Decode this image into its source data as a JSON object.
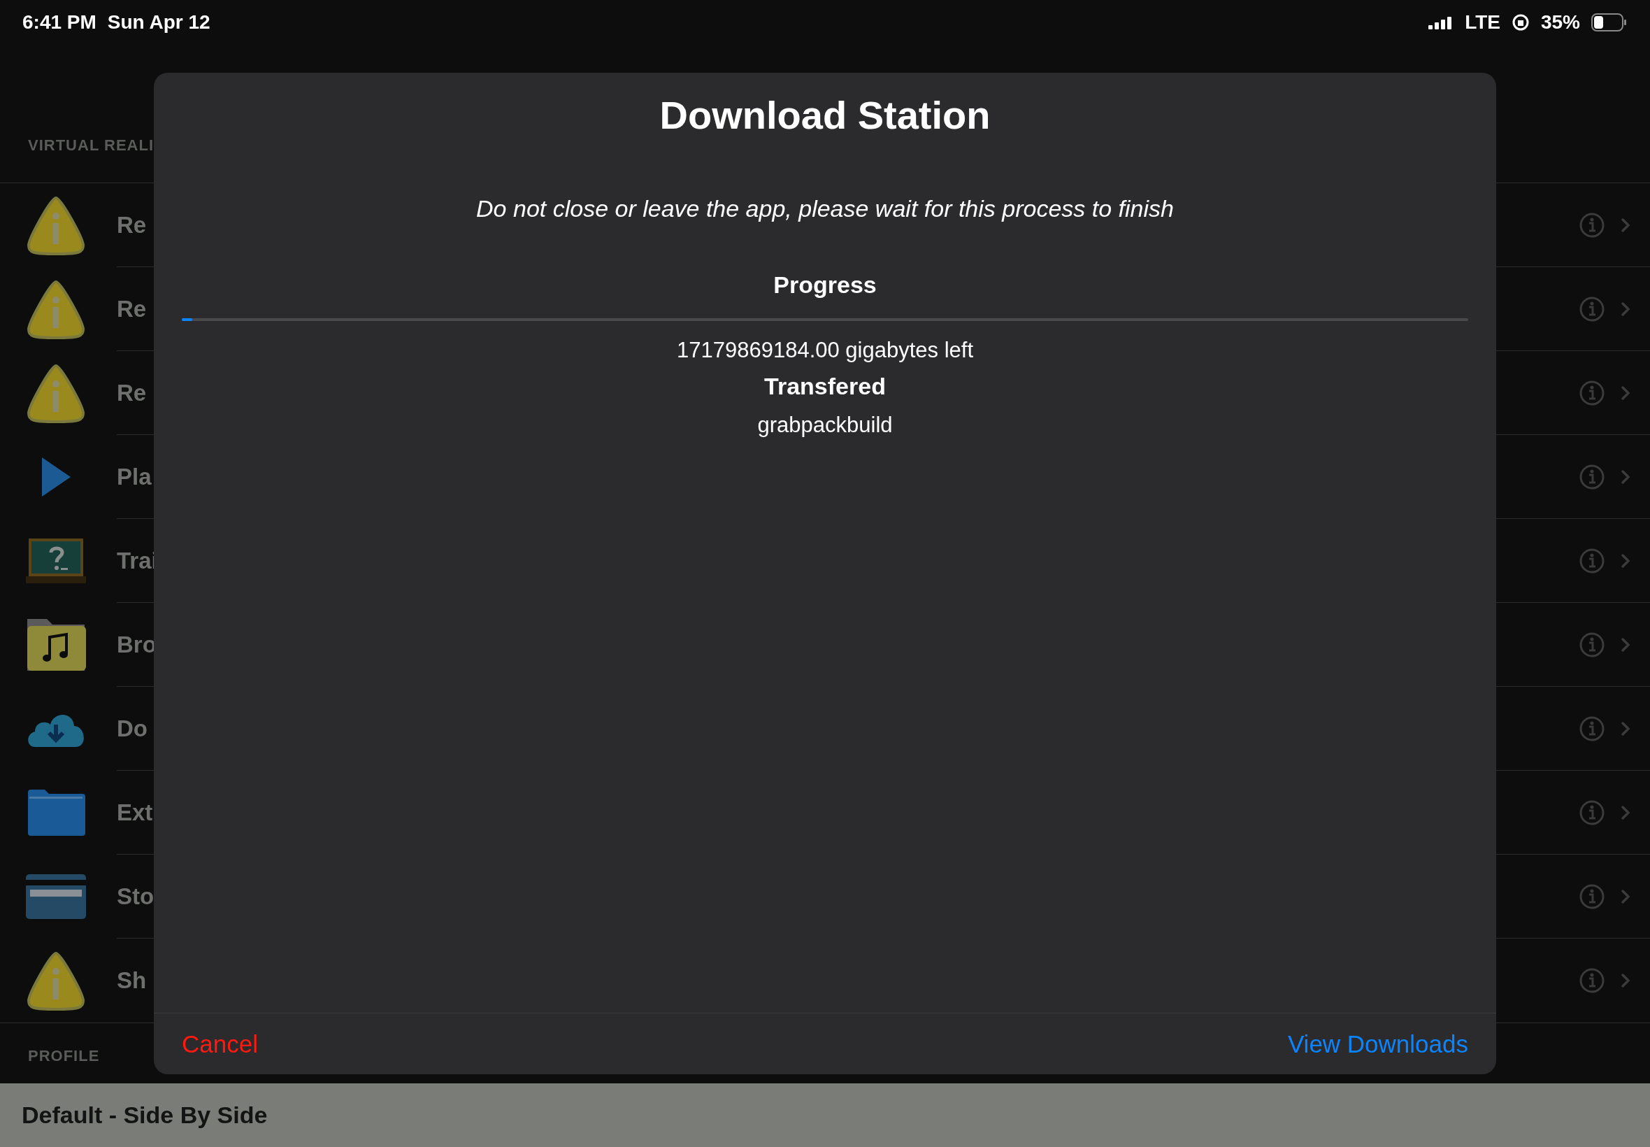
{
  "status_bar": {
    "time": "6:41 PM",
    "date": "Sun Apr 12",
    "network": "LTE",
    "battery": "35%"
  },
  "list": {
    "header": "VIRTUAL REALI",
    "rows": [
      {
        "kind": "warning",
        "label": "Re"
      },
      {
        "kind": "warning",
        "label": "Re"
      },
      {
        "kind": "warning",
        "label": "Re"
      },
      {
        "kind": "play",
        "label": "Pla"
      },
      {
        "kind": "board",
        "label": "Trai"
      },
      {
        "kind": "music",
        "label": "Bro"
      },
      {
        "kind": "cloud",
        "label": "Do"
      },
      {
        "kind": "folder",
        "label": "Ext"
      },
      {
        "kind": "card",
        "label": "Sto"
      },
      {
        "kind": "warning",
        "label": "Sh"
      }
    ]
  },
  "profile": {
    "header": "PROFILE",
    "value": "Default - Side By Side"
  },
  "dialog": {
    "title": "Download Station",
    "message": "Do not close or leave the app, please wait for this process to finish",
    "progress_label": "Progress",
    "level": 0.008,
    "remaining": "17179869184.00 gigabytes left",
    "transferred_label": "Transfered",
    "file": "grabpackbuild",
    "buttons": [
      {
        "kind": "cancel",
        "label": "Cancel"
      },
      {
        "kind": "primary",
        "label": "View Downloads"
      }
    ]
  }
}
